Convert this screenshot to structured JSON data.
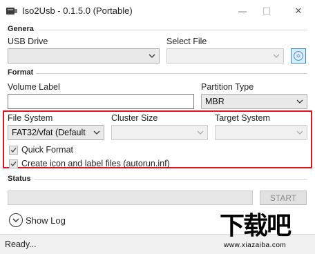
{
  "window": {
    "title": "Iso2Usb - 0.1.5.0 (Portable)",
    "minimize_glyph": "—",
    "maximize_glyph": "☐",
    "close_glyph": "✕"
  },
  "general": {
    "section_title": "Genera",
    "usb_drive_label": "USB Drive",
    "usb_drive_value": "",
    "select_file_label": "Select File",
    "select_file_value": "",
    "browse_icon": "disc-browse-icon"
  },
  "format": {
    "section_title": "Format",
    "volume_label_label": "Volume Label",
    "volume_label_value": "",
    "partition_type_label": "Partition Type",
    "partition_type_value": "MBR",
    "file_system_label": "File System",
    "file_system_value": "FAT32/vfat (Default",
    "cluster_size_label": "Cluster Size",
    "cluster_size_value": "",
    "target_system_label": "Target System",
    "target_system_value": "",
    "quick_format_label": "Quick Format",
    "quick_format_checked": true,
    "autorun_label": "Create icon and label files (autorun.inf)",
    "autorun_checked": true,
    "highlight_color": "#e0141e"
  },
  "status": {
    "section_title": "Status",
    "progress": 0,
    "start_label": "START",
    "show_log_label": "Show Log",
    "statusbar_text": "Ready..."
  },
  "watermark": {
    "main_text": "下载吧",
    "sub_text": "www.xiazaiba.com"
  }
}
